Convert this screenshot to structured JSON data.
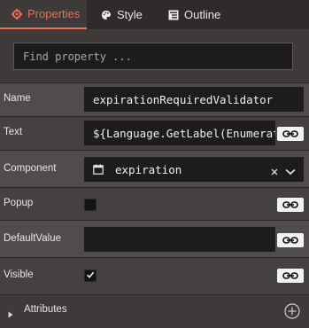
{
  "tabs": [
    {
      "label": "Properties",
      "icon": "gear-icon",
      "active": true
    },
    {
      "label": "Style",
      "icon": "palette-icon",
      "active": false
    },
    {
      "label": "Outline",
      "icon": "outline-icon",
      "active": false
    }
  ],
  "search": {
    "placeholder": "Find property ..."
  },
  "properties": {
    "name": {
      "label": "Name",
      "value": "expirationRequiredValidator"
    },
    "text": {
      "label": "Text",
      "value": "${Language.GetLabel(Enumerato"
    },
    "component": {
      "label": "Component",
      "value": "expiration",
      "icon": "calendar-icon"
    },
    "popup": {
      "label": "Popup",
      "checked": false
    },
    "default_value": {
      "label": "DefaultValue",
      "value": ""
    },
    "visible": {
      "label": "Visible",
      "checked": true
    }
  },
  "attributes": {
    "label": "Attributes"
  },
  "colors": {
    "accent": "#f36c4f",
    "panel": "#3d3a39",
    "field": "#1d1b1b"
  }
}
